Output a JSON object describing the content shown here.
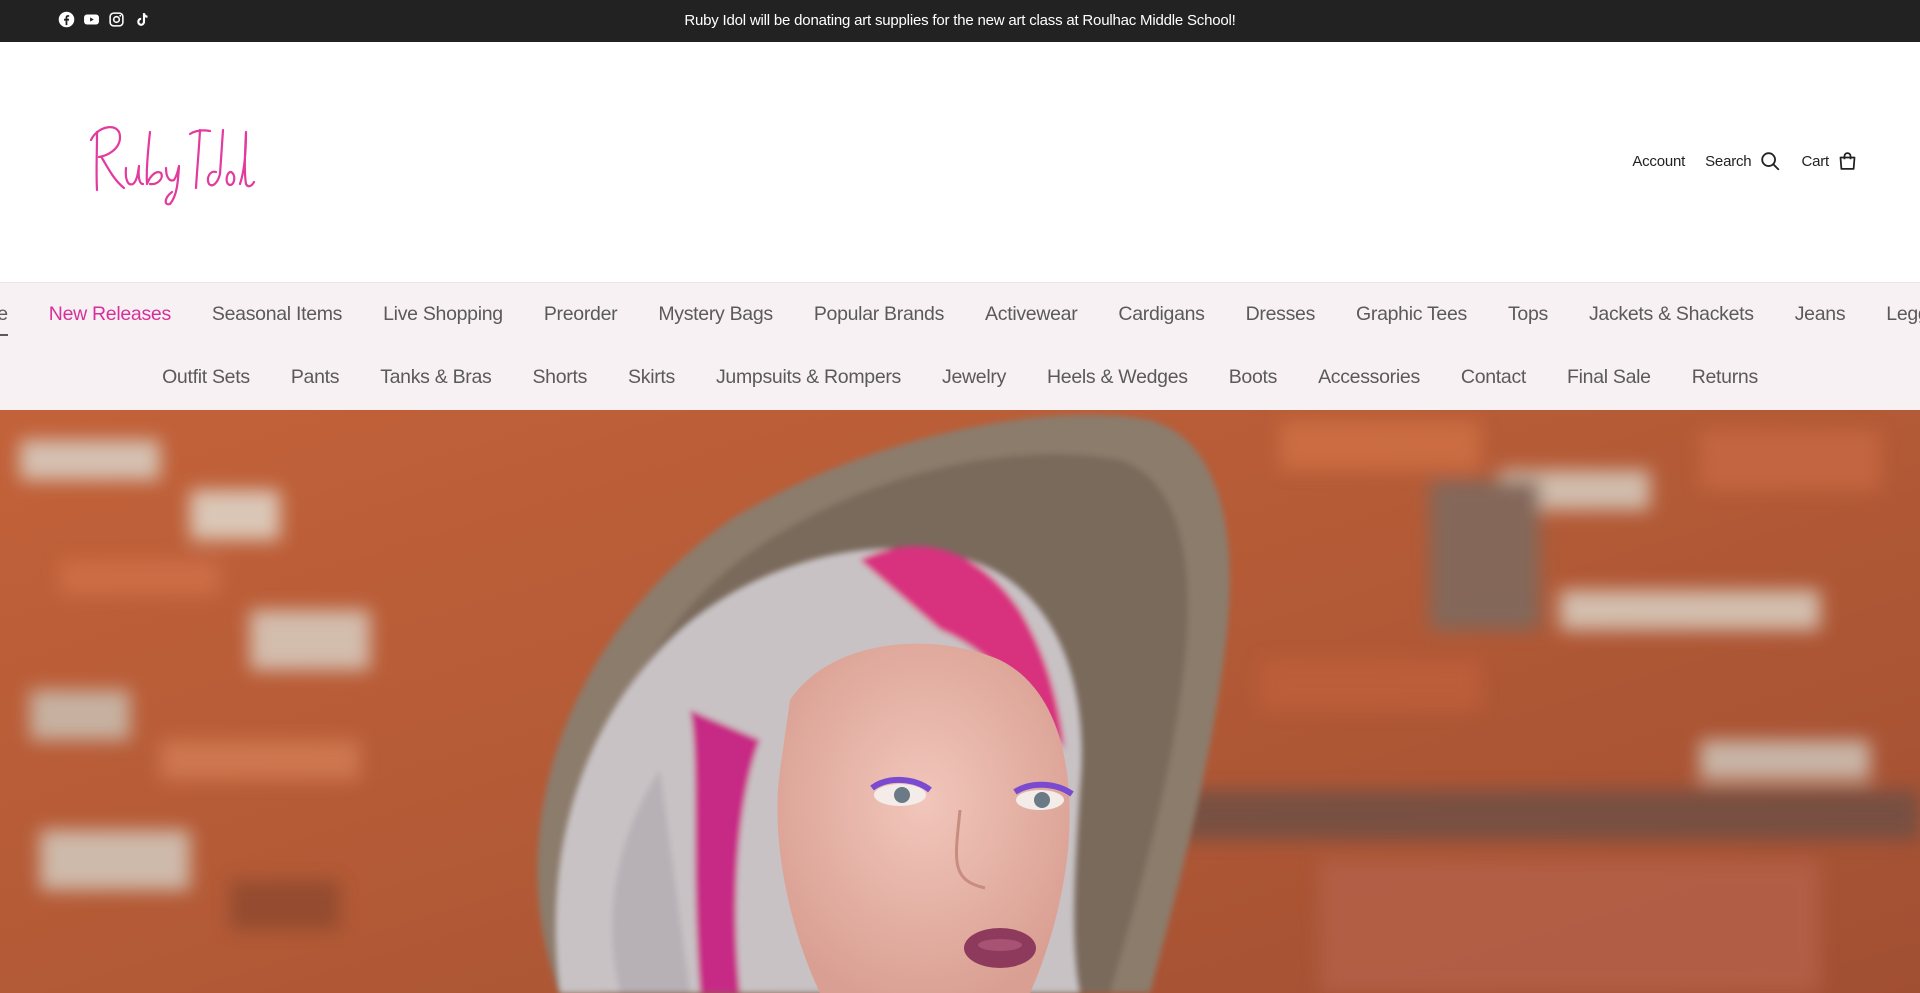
{
  "announcement": {
    "text": "Ruby Idol will be donating art supplies for the new art class at Roulhac Middle School!",
    "social_icons": [
      "facebook-icon",
      "youtube-icon",
      "instagram-icon",
      "tiktok-icon"
    ]
  },
  "header": {
    "logo_text": "Ruby Idol",
    "account_label": "Account",
    "search_label": "Search",
    "cart_label": "Cart"
  },
  "nav": {
    "row1": [
      {
        "label": "Home",
        "active": true
      },
      {
        "label": "New Releases",
        "accent": true
      },
      {
        "label": "Seasonal Items"
      },
      {
        "label": "Live Shopping"
      },
      {
        "label": "Preorder"
      },
      {
        "label": "Mystery Bags"
      },
      {
        "label": "Popular Brands"
      },
      {
        "label": "Activewear"
      },
      {
        "label": "Cardigans"
      },
      {
        "label": "Dresses"
      },
      {
        "label": "Graphic Tees"
      },
      {
        "label": "Tops"
      },
      {
        "label": "Jackets & Shackets"
      },
      {
        "label": "Jeans"
      },
      {
        "label": "Leggings"
      }
    ],
    "row2": [
      {
        "label": "Outfit Sets"
      },
      {
        "label": "Pants"
      },
      {
        "label": "Tanks & Bras"
      },
      {
        "label": "Shorts"
      },
      {
        "label": "Skirts"
      },
      {
        "label": "Jumpsuits & Rompers"
      },
      {
        "label": "Jewelry"
      },
      {
        "label": "Heels & Wedges"
      },
      {
        "label": "Boots"
      },
      {
        "label": "Accessories"
      },
      {
        "label": "Contact"
      },
      {
        "label": "Final Sale"
      },
      {
        "label": "Returns"
      }
    ]
  },
  "colors": {
    "announcement_bg": "#222222",
    "accent": "#d6319a",
    "nav_bg": "#f8f1f4",
    "nav_text": "#5a5a5a"
  },
  "hero": {
    "image": "hero-photo"
  }
}
